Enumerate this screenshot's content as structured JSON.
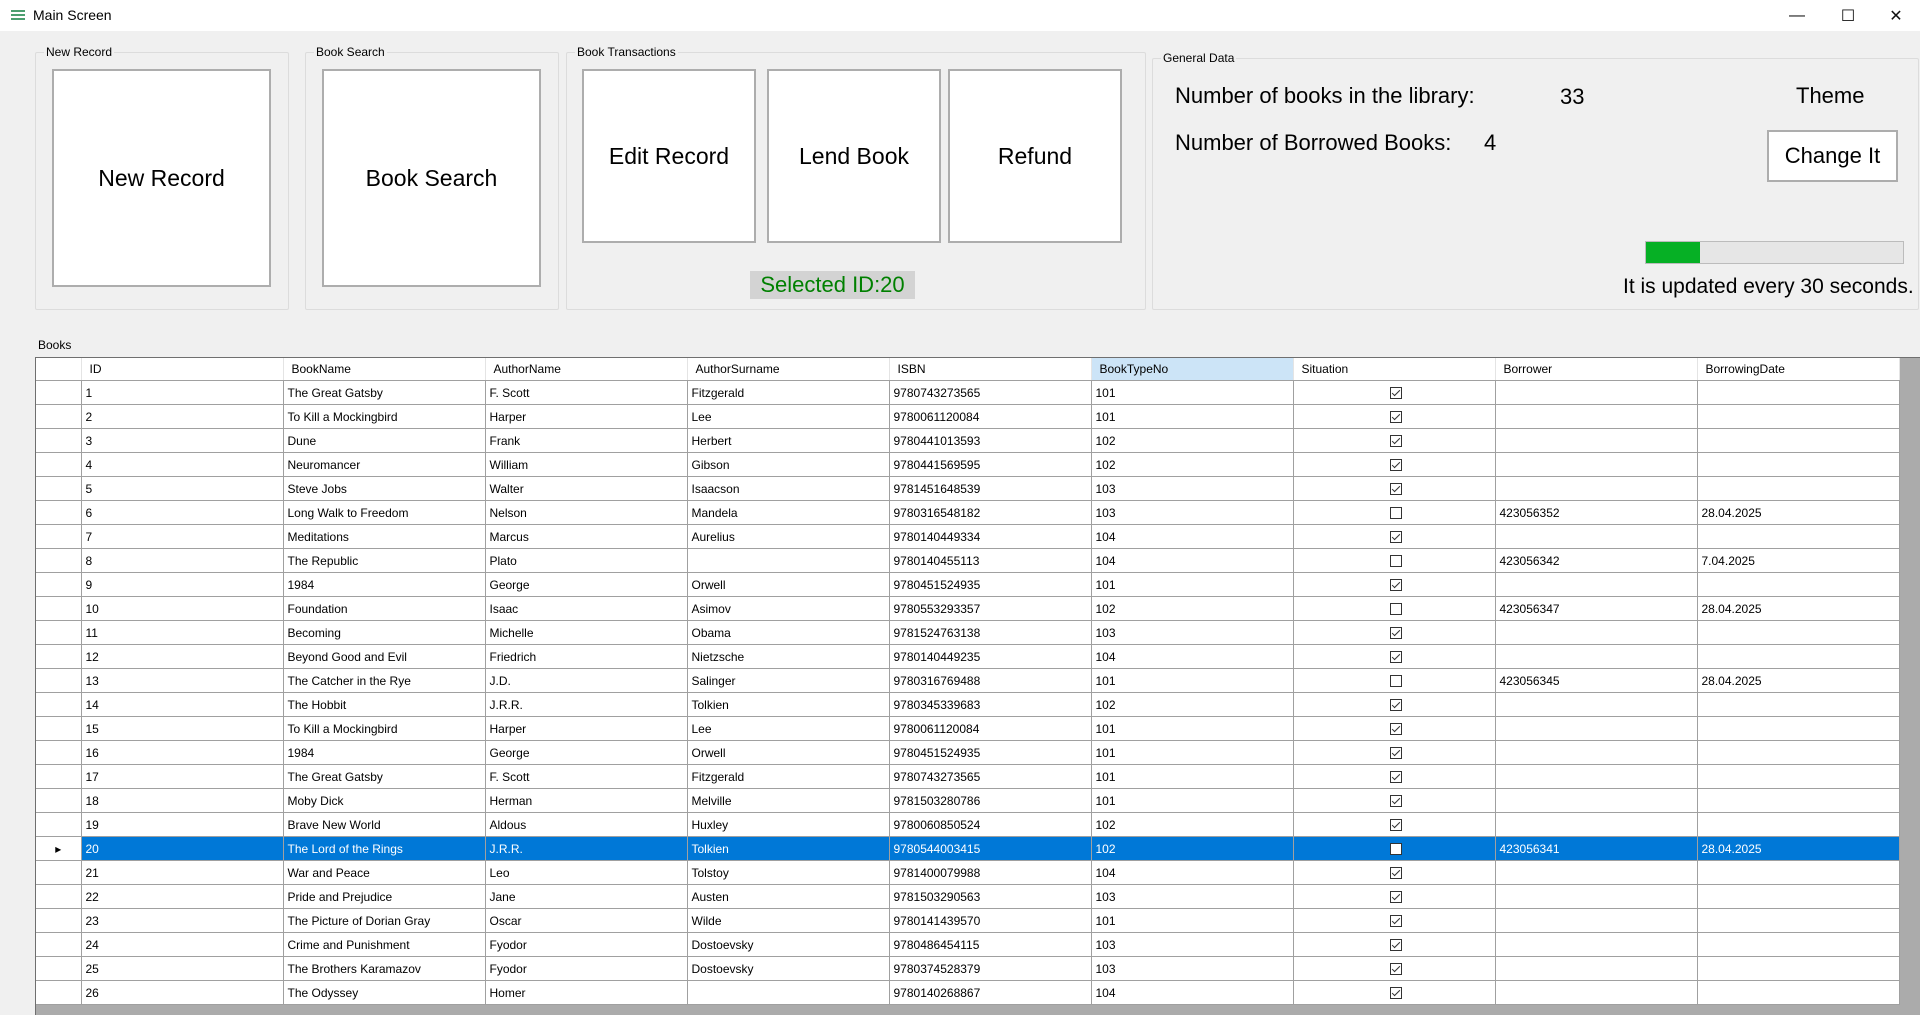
{
  "window": {
    "title": "Main Screen"
  },
  "new_record": {
    "group_label": "New Record",
    "button": "New Record"
  },
  "book_search": {
    "group_label": "Book Search",
    "button": "Book Search"
  },
  "transactions": {
    "group_label": "Book Transactions",
    "edit": "Edit Record",
    "lend": "Lend Book",
    "refund": "Refund",
    "selected_id": "Selected ID:20"
  },
  "general": {
    "group_label": "General Data",
    "books_label": "Number of books in the library:",
    "books_value": "33",
    "borrowed_label": "Number of Borrowed Books:",
    "borrowed_value": "4",
    "theme_label": "Theme",
    "change_button": "Change It",
    "progress_fraction": 0.21,
    "progress_color": "#06b025",
    "update_note": "It is updated every 30 seconds."
  },
  "books": {
    "group_label": "Books",
    "columns": [
      "ID",
      "BookName",
      "AuthorName",
      "AuthorSurname",
      "ISBN",
      "BookTypeNo",
      "Situation",
      "Borrower",
      "BorrowingDate"
    ],
    "active_column": "BookTypeNo",
    "selected_id": "20",
    "rows": [
      [
        "1",
        "The Great Gatsby",
        "F. Scott",
        "Fitzgerald",
        "9780743273565",
        "101",
        true,
        "",
        ""
      ],
      [
        "2",
        "To Kill a Mockingbird",
        "Harper",
        "Lee",
        "9780061120084",
        "101",
        true,
        "",
        ""
      ],
      [
        "3",
        "Dune",
        "Frank",
        "Herbert",
        "9780441013593",
        "102",
        true,
        "",
        ""
      ],
      [
        "4",
        "Neuromancer",
        "William",
        "Gibson",
        "9780441569595",
        "102",
        true,
        "",
        ""
      ],
      [
        "5",
        "Steve Jobs",
        "Walter",
        "Isaacson",
        "9781451648539",
        "103",
        true,
        "",
        ""
      ],
      [
        "6",
        "Long Walk to Freedom",
        "Nelson",
        "Mandela",
        "9780316548182",
        "103",
        false,
        "423056352",
        "28.04.2025"
      ],
      [
        "7",
        "Meditations",
        "Marcus",
        "Aurelius",
        "9780140449334",
        "104",
        true,
        "",
        ""
      ],
      [
        "8",
        "The Republic",
        "Plato",
        "",
        "9780140455113",
        "104",
        false,
        "423056342",
        "7.04.2025"
      ],
      [
        "9",
        "1984",
        "George",
        "Orwell",
        "9780451524935",
        "101",
        true,
        "",
        ""
      ],
      [
        "10",
        "Foundation",
        "Isaac",
        "Asimov",
        "9780553293357",
        "102",
        false,
        "423056347",
        "28.04.2025"
      ],
      [
        "11",
        "Becoming",
        "Michelle",
        "Obama",
        "9781524763138",
        "103",
        true,
        "",
        ""
      ],
      [
        "12",
        "Beyond Good and Evil",
        "Friedrich",
        "Nietzsche",
        "9780140449235",
        "104",
        true,
        "",
        ""
      ],
      [
        "13",
        "The Catcher in the Rye",
        "J.D.",
        "Salinger",
        "9780316769488",
        "101",
        false,
        "423056345",
        "28.04.2025"
      ],
      [
        "14",
        "The Hobbit",
        "J.R.R.",
        "Tolkien",
        "9780345339683",
        "102",
        true,
        "",
        ""
      ],
      [
        "15",
        "To Kill a Mockingbird",
        "Harper",
        "Lee",
        "9780061120084",
        "101",
        true,
        "",
        ""
      ],
      [
        "16",
        "1984",
        "George",
        "Orwell",
        "9780451524935",
        "101",
        true,
        "",
        ""
      ],
      [
        "17",
        "The Great Gatsby",
        "F. Scott",
        "Fitzgerald",
        "9780743273565",
        "101",
        true,
        "",
        ""
      ],
      [
        "18",
        "Moby Dick",
        "Herman",
        "Melville",
        "9781503280786",
        "101",
        true,
        "",
        ""
      ],
      [
        "19",
        "Brave New World",
        "Aldous",
        "Huxley",
        "9780060850524",
        "102",
        true,
        "",
        ""
      ],
      [
        "20",
        "The Lord of the Rings",
        "J.R.R.",
        "Tolkien",
        "9780544003415",
        "102",
        false,
        "423056341",
        "28.04.2025"
      ],
      [
        "21",
        "War and Peace",
        "Leo",
        "Tolstoy",
        "9781400079988",
        "104",
        true,
        "",
        ""
      ],
      [
        "22",
        "Pride and Prejudice",
        "Jane",
        "Austen",
        "9781503290563",
        "103",
        true,
        "",
        ""
      ],
      [
        "23",
        "The Picture of Dorian Gray",
        "Oscar",
        "Wilde",
        "9780141439570",
        "101",
        true,
        "",
        ""
      ],
      [
        "24",
        "Crime and Punishment",
        "Fyodor",
        "Dostoevsky",
        "9780486454115",
        "103",
        true,
        "",
        ""
      ],
      [
        "25",
        "The Brothers Karamazov",
        "Fyodor",
        "Dostoevsky",
        "9780374528379",
        "103",
        true,
        "",
        ""
      ],
      [
        "26",
        "The Odyssey",
        "Homer",
        "",
        "9780140268867",
        "104",
        true,
        "",
        ""
      ]
    ]
  }
}
